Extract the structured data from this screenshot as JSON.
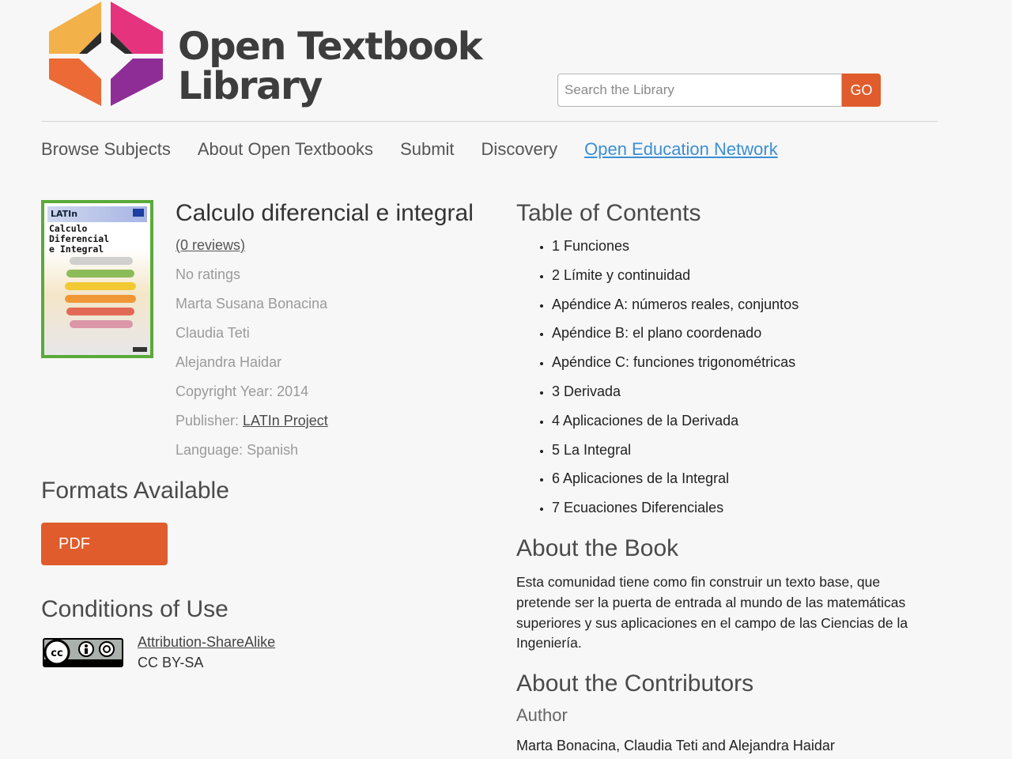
{
  "site": {
    "logo_line1": "Open Textbook",
    "logo_line2": "Library"
  },
  "search": {
    "placeholder": "Search the Library",
    "go_label": "GO"
  },
  "nav": {
    "items": [
      "Browse Subjects",
      "About Open Textbooks",
      "Submit",
      "Discovery",
      "Open Education Network"
    ]
  },
  "book": {
    "cover_logo": "LATIn",
    "cover_title_line1": "Calculo  Diferencial",
    "cover_title_line2": "e Integral",
    "title": "Calculo diferencial e integral",
    "reviews": "(0 reviews)",
    "ratings": "No ratings",
    "authors": [
      "Marta Susana Bonacina",
      "Claudia Teti",
      "Alejandra Haidar"
    ],
    "copyright": "Copyright Year: 2014",
    "publisher_label": "Publisher: ",
    "publisher": "LATIn Project",
    "language": "Language: Spanish"
  },
  "formats": {
    "heading": "Formats Available",
    "pdf_label": "PDF"
  },
  "conditions": {
    "heading": "Conditions of Use",
    "license_name": "Attribution-ShareAlike",
    "license_code": "CC BY-SA"
  },
  "toc": {
    "heading": "Table of Contents",
    "items": [
      "1 Funciones",
      "2 Límite y continuidad",
      "Apéndice A: números reales, conjuntos",
      "Apéndice B: el plano coordenado",
      "Apéndice C: funciones trigonométricas",
      "3 Derivada",
      "4 Aplicaciones de la Derivada",
      "5 La Integral",
      "6 Aplicaciones de la Integral",
      "7 Ecuaciones Diferenciales"
    ]
  },
  "about_book": {
    "heading": "About the Book",
    "text": "Esta comunidad tiene como fin construir un texto base, que pretende ser la puerta de entrada al mundo de las matemáticas superiores y sus aplicaciones en el campo de las Ciencias de la Ingeniería."
  },
  "contributors": {
    "heading": "About the Contributors",
    "author_label": "Author",
    "authors_text": "Marta Bonacina, Claudia Teti and Alejandra Haidar"
  },
  "colors": {
    "accent": "#e05c2c",
    "link_blue": "#3b8fd6",
    "cover_border": "#5aaa3a"
  }
}
